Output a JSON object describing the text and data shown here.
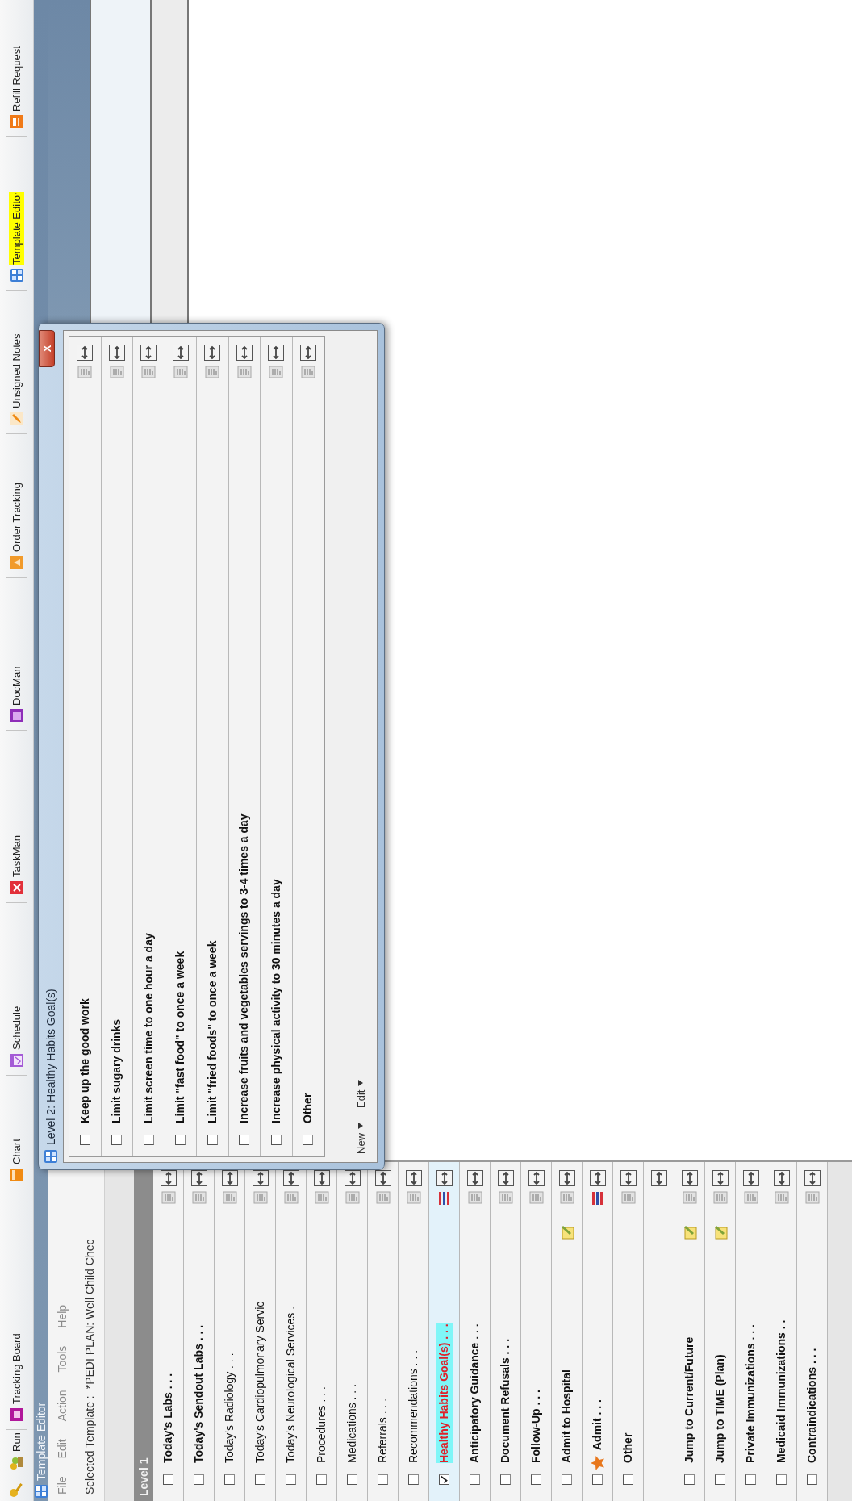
{
  "toolbar": [
    {
      "label": "Run",
      "highlighted": false
    },
    {
      "label": "Tracking Board",
      "highlighted": false
    },
    {
      "label": "Chart",
      "highlighted": false
    },
    {
      "label": "Schedule",
      "highlighted": false
    },
    {
      "label": "TaskMan",
      "highlighted": false
    },
    {
      "label": "DocMan",
      "highlighted": false
    },
    {
      "label": "Order Tracking",
      "highlighted": false
    },
    {
      "label": "Unsigned Notes",
      "highlighted": false
    },
    {
      "label": "Template Editor",
      "highlighted": true
    },
    {
      "label": "Refill Request",
      "highlighted": false
    }
  ],
  "window": {
    "title": "Template Editor"
  },
  "menu": [
    "File",
    "Edit",
    "Action",
    "Tools",
    "Help"
  ],
  "selected_template": {
    "label": "Selected Template :",
    "value": "*PEDI PLAN: Well Child Chec"
  },
  "panel": {
    "title": "Level 1",
    "rows": [
      {
        "label": "Today's Labs . . .",
        "bold": true,
        "checked": false,
        "selected": false,
        "kind": "item"
      },
      {
        "label": "Today's Sendout Labs . . .",
        "bold": true,
        "checked": false,
        "selected": false,
        "kind": "item"
      },
      {
        "label": "Today's Radiology . . .",
        "bold": false,
        "checked": false,
        "selected": false,
        "kind": "item"
      },
      {
        "label": "Today's Cardiopulmonary Servic",
        "bold": false,
        "checked": false,
        "selected": false,
        "kind": "item"
      },
      {
        "label": "Today's Neurological Services .",
        "bold": false,
        "checked": false,
        "selected": false,
        "kind": "item"
      },
      {
        "label": "Procedures . . .",
        "bold": false,
        "checked": false,
        "selected": false,
        "kind": "item"
      },
      {
        "label": "Medications . . .",
        "bold": false,
        "checked": false,
        "selected": false,
        "kind": "item"
      },
      {
        "label": "Referrals . . .",
        "bold": false,
        "checked": false,
        "selected": false,
        "kind": "item"
      },
      {
        "label": "Recommendations . . .",
        "bold": false,
        "checked": false,
        "selected": false,
        "kind": "item"
      },
      {
        "label": "Healthy Habits Goal(s) . . .",
        "bold": true,
        "checked": true,
        "selected": true,
        "kind": "flagged"
      },
      {
        "label": "Anticipatory Guidance . . .",
        "bold": true,
        "checked": false,
        "selected": false,
        "kind": "item"
      },
      {
        "label": "Document Refusals . . .",
        "bold": true,
        "checked": false,
        "selected": false,
        "kind": "item"
      },
      {
        "label": "Follow-Up . . .",
        "bold": true,
        "checked": false,
        "selected": false,
        "kind": "item"
      },
      {
        "label": "Admit to Hospital",
        "bold": true,
        "checked": false,
        "selected": false,
        "kind": "note"
      },
      {
        "label": "Admit . . .",
        "bold": true,
        "checked": false,
        "selected": false,
        "kind": "starred"
      },
      {
        "label": "Other",
        "bold": true,
        "checked": false,
        "selected": false,
        "kind": "item"
      },
      {
        "kind": "spacer"
      },
      {
        "label": "Jump to Current/Future",
        "bold": true,
        "checked": false,
        "selected": false,
        "kind": "note"
      },
      {
        "label": "Jump to TIME (Plan)",
        "bold": true,
        "checked": false,
        "selected": false,
        "kind": "note"
      },
      {
        "label": "Private Immunizations . . .",
        "bold": true,
        "checked": false,
        "selected": false,
        "kind": "item"
      },
      {
        "label": "Medicaid Immunizations . .",
        "bold": true,
        "checked": false,
        "selected": false,
        "kind": "item"
      },
      {
        "label": "Contraindications . . .",
        "bold": true,
        "checked": false,
        "selected": false,
        "kind": "item"
      }
    ]
  },
  "dialog": {
    "title": "Level 2: Healthy Habits Goal(s)",
    "close": "X",
    "rows": [
      {
        "label": "Keep up the good work",
        "checked": false
      },
      {
        "label": "Limit sugary drinks",
        "checked": false
      },
      {
        "label": "Limit screen time to one hour a day",
        "checked": false
      },
      {
        "label": "Limit \"fast food\" to once a week",
        "checked": false
      },
      {
        "label": "Limit \"fried foods\" to once a week",
        "checked": false
      },
      {
        "label": "Increase fruits and vegetables servings to 3-4 times a day",
        "checked": false
      },
      {
        "label": "Increase physical activity to 30 minutes a day",
        "checked": false
      },
      {
        "label": "Other",
        "checked": false
      }
    ],
    "footer": [
      "New",
      "Edit"
    ]
  }
}
